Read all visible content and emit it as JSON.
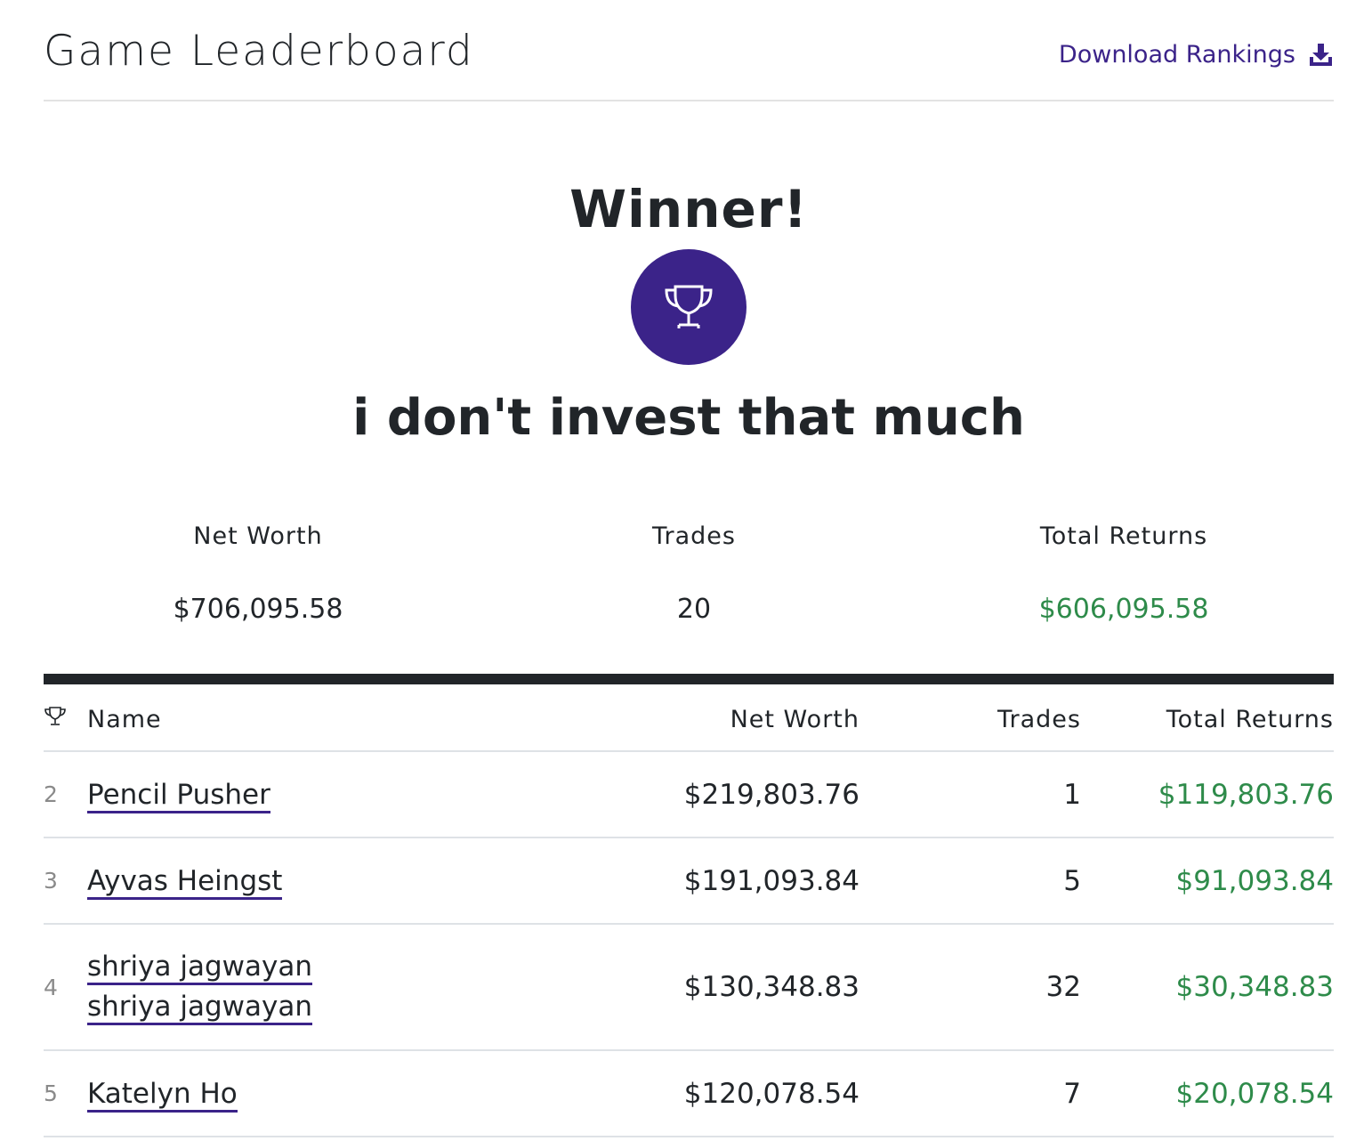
{
  "header": {
    "title": "Game Leaderboard",
    "download_label": "Download Rankings"
  },
  "winner": {
    "heading": "Winner!",
    "name": "i don't invest that much"
  },
  "stats": {
    "net_worth_label": "Net Worth",
    "net_worth_value": "$706,095.58",
    "trades_label": "Trades",
    "trades_value": "20",
    "total_returns_label": "Total Returns",
    "total_returns_value": "$606,095.58"
  },
  "table": {
    "columns": {
      "name": "Name",
      "net_worth": "Net Worth",
      "trades": "Trades",
      "total_returns": "Total Returns"
    },
    "rows": [
      {
        "rank": "2",
        "name": "Pencil Pusher",
        "net_worth": "$219,803.76",
        "trades": "1",
        "total_returns": "$119,803.76"
      },
      {
        "rank": "3",
        "name": "Ayvas Heingst",
        "net_worth": "$191,093.84",
        "trades": "5",
        "total_returns": "$91,093.84"
      },
      {
        "rank": "4",
        "name": "shriya jagwayan shriya jagwayan",
        "net_worth": "$130,348.83",
        "trades": "32",
        "total_returns": "$30,348.83"
      },
      {
        "rank": "5",
        "name": "Katelyn Ho",
        "net_worth": "$120,078.54",
        "trades": "7",
        "total_returns": "$20,078.54"
      }
    ]
  },
  "colors": {
    "accent": "#3b2389",
    "positive": "#2e8b4a",
    "text": "#212529"
  },
  "icons": {
    "download": "download-icon",
    "trophy": "trophy-icon"
  }
}
